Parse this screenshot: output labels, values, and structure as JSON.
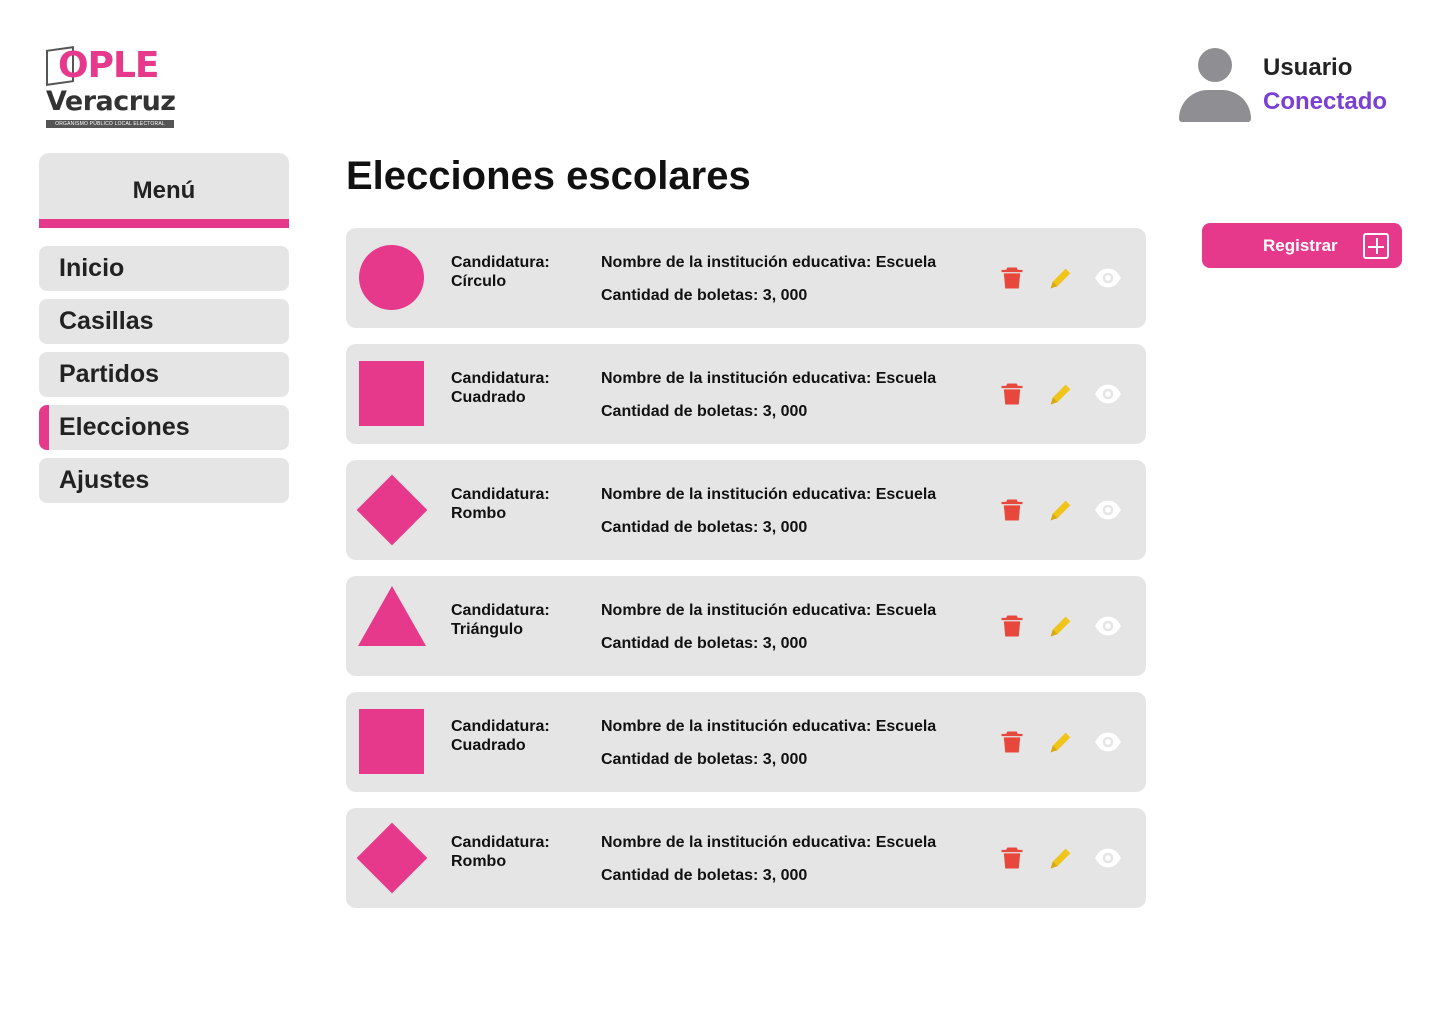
{
  "logo": {
    "brand": "OPLE",
    "region": "Veracruz",
    "subtitle": "ORGANISMO PÚBLICO LOCAL ELECTORAL"
  },
  "user": {
    "name": "Usuario",
    "status": "Conectado",
    "status_color": "#7a3fd3"
  },
  "sidebar": {
    "title": "Menú",
    "items": [
      {
        "label": "Inicio",
        "active": false
      },
      {
        "label": "Casillas",
        "active": false
      },
      {
        "label": "Partidos",
        "active": false
      },
      {
        "label": "Elecciones",
        "active": true
      },
      {
        "label": "Ajustes",
        "active": false
      }
    ]
  },
  "main": {
    "title": "Elecciones escolares",
    "register_label": "Registrar",
    "cards": [
      {
        "shape": "circle",
        "label": "Candidatura:",
        "candidate": "Círculo",
        "institution": "Nombre de la institución educativa: Escuela",
        "ballots": "Cantidad de boletas: 3, 000"
      },
      {
        "shape": "square",
        "label": "Candidatura:",
        "candidate": "Cuadrado",
        "institution": "Nombre de la institución educativa: Escuela",
        "ballots": "Cantidad de boletas: 3, 000"
      },
      {
        "shape": "diamond",
        "label": "Candidatura:",
        "candidate": "Rombo",
        "institution": "Nombre de la institución educativa: Escuela",
        "ballots": "Cantidad de boletas: 3, 000"
      },
      {
        "shape": "triangle",
        "label": "Candidatura:",
        "candidate": "Triángulo",
        "institution": "Nombre de la institución educativa: Escuela",
        "ballots": "Cantidad de boletas: 3, 000"
      },
      {
        "shape": "square",
        "label": "Candidatura:",
        "candidate": "Cuadrado",
        "institution": "Nombre de la institución educativa: Escuela",
        "ballots": "Cantidad de boletas: 3, 000"
      },
      {
        "shape": "diamond",
        "label": "Candidatura:",
        "candidate": "Rombo",
        "institution": "Nombre de la institución educativa: Escuela",
        "ballots": "Cantidad de boletas: 3, 000"
      }
    ],
    "actions": {
      "delete_icon": "trash-icon",
      "edit_icon": "pencil-icon",
      "view_icon": "eye-icon"
    }
  },
  "colors": {
    "accent": "#e6398b",
    "card_bg": "#e5e5e5",
    "delete": "#e8483b",
    "edit": "#f0c419",
    "view": "#ffffff"
  }
}
